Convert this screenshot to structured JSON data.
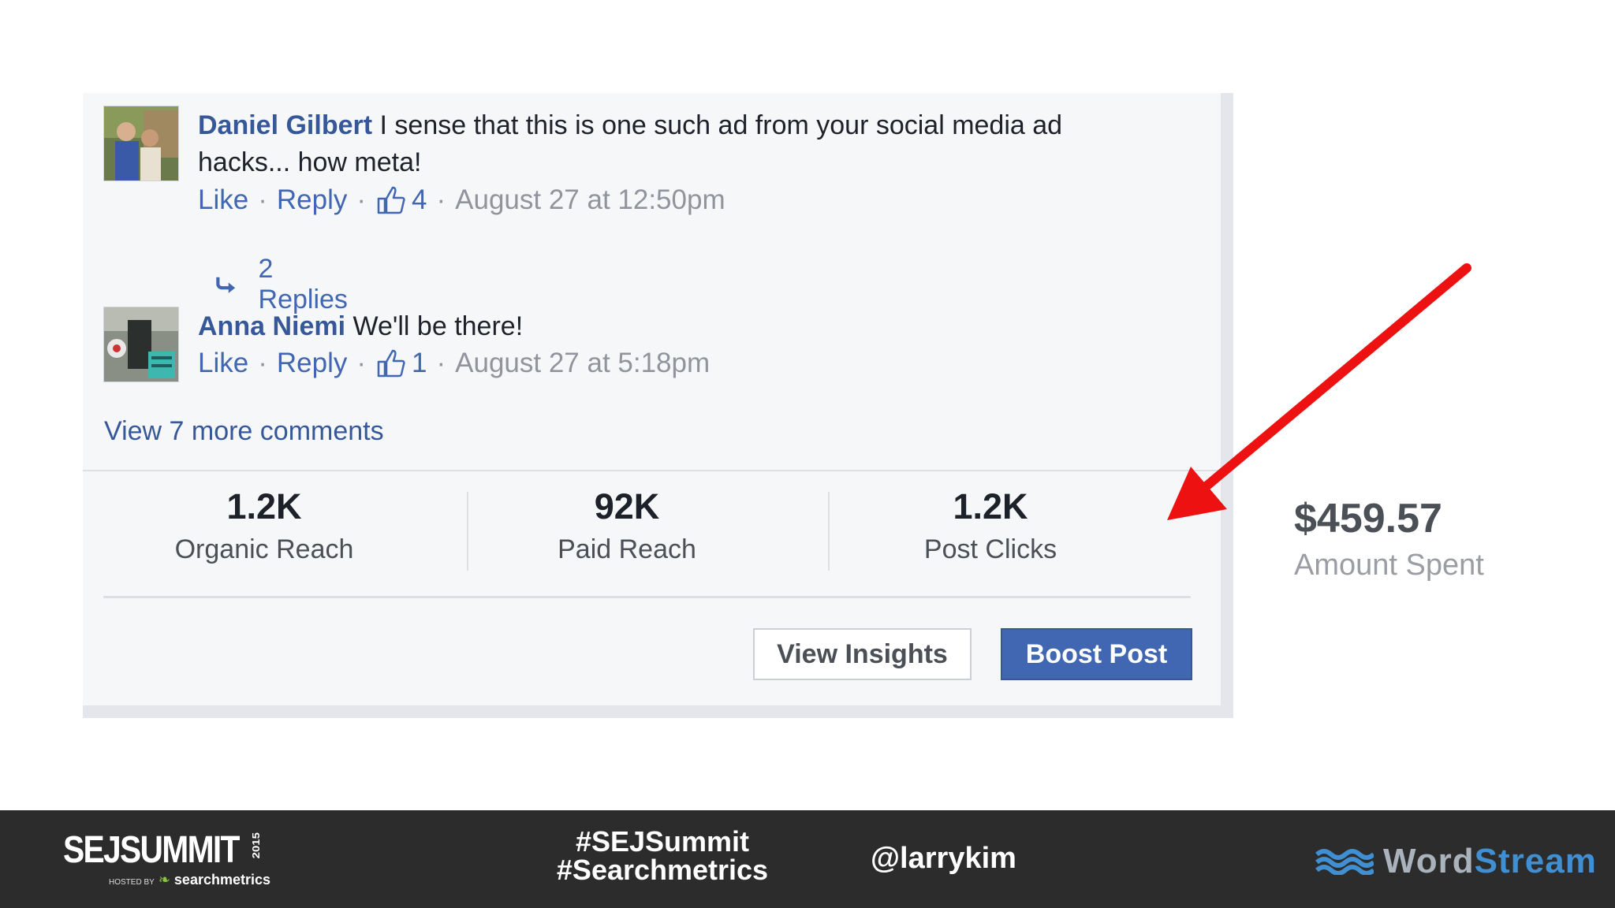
{
  "comments": [
    {
      "author": "Daniel Gilbert",
      "text": "I sense that this is one such ad from your social media ad hacks... how meta!",
      "like_label": "Like",
      "reply_label": "Reply",
      "likes": "4",
      "time": "August 27 at 12:50pm",
      "replies_label": "2 Replies"
    },
    {
      "author": "Anna Niemi",
      "text": "We'll be there!",
      "like_label": "Like",
      "reply_label": "Reply",
      "likes": "1",
      "time": "August 27 at 5:18pm"
    }
  ],
  "view_more": "View 7 more comments",
  "stats": [
    {
      "value": "1.2K",
      "label": "Organic Reach"
    },
    {
      "value": "92K",
      "label": "Paid Reach"
    },
    {
      "value": "1.2K",
      "label": "Post Clicks"
    }
  ],
  "buttons": {
    "view_insights": "View Insights",
    "boost_post": "Boost Post"
  },
  "amount": {
    "value": "$459.57",
    "label": "Amount Spent"
  },
  "footer": {
    "sej_logo": "SEJSUMMIT",
    "sej_year": "2015",
    "sej_sub_prefix": "HOSTED BY",
    "sej_sub": "searchmetrics",
    "hashtag1": "#SEJSummit",
    "hashtag2": "#Searchmetrics",
    "handle": "@larrykim",
    "wordstream_word": "Word",
    "wordstream_stream": "Stream"
  },
  "colors": {
    "fb_blue": "#4267b2",
    "arrow": "#ee1111",
    "footer_bg": "#2c2c2c"
  }
}
